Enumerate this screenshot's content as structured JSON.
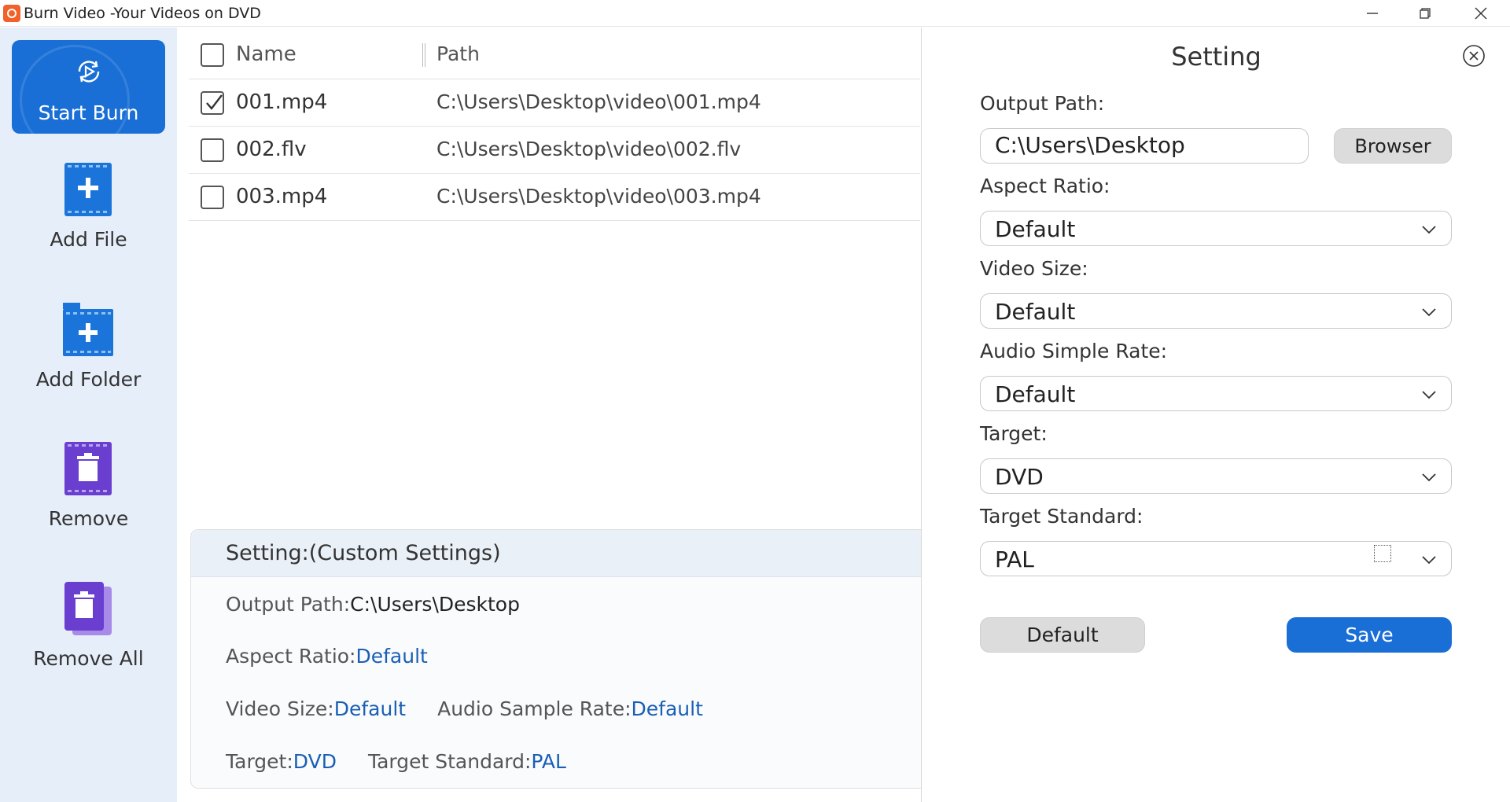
{
  "window": {
    "title": "Burn Video -Your Videos on DVD",
    "icon": "app-disc-icon"
  },
  "sidebar": {
    "start_burn": "Start Burn",
    "items": [
      {
        "label": "Add File",
        "icon": "add-file-icon"
      },
      {
        "label": "Add Folder",
        "icon": "add-folder-icon"
      },
      {
        "label": "Remove",
        "icon": "remove-icon"
      },
      {
        "label": "Remove All",
        "icon": "remove-all-icon"
      }
    ]
  },
  "filelist": {
    "columns": {
      "name": "Name",
      "path": "Path"
    },
    "rows": [
      {
        "name": "001.mp4",
        "path": "C:\\Users\\Desktop\\video\\001.mp4",
        "checked": true
      },
      {
        "name": "002.flv",
        "path": "C:\\Users\\Desktop\\video\\002.flv",
        "checked": false
      },
      {
        "name": "003.mp4",
        "path": "C:\\Users\\Desktop\\video\\003.mp4",
        "checked": false
      }
    ]
  },
  "summary": {
    "title": "Setting:(Custom Settings)",
    "output_path_label": "Output Path:",
    "output_path_value": "C:\\Users\\Desktop",
    "aspect_ratio_label": "Aspect Ratio:",
    "aspect_ratio_value": "Default",
    "video_size_label": "Video Size:",
    "video_size_value": "Default",
    "audio_rate_label": "Audio Sample Rate:",
    "audio_rate_value": "Default",
    "target_label": "Target:",
    "target_value": "DVD",
    "standard_label": "Target Standard:",
    "standard_value": "PAL"
  },
  "setting": {
    "title": "Setting",
    "output_path_label": "Output Path:",
    "output_path_value": "C:\\Users\\Desktop",
    "browser_button": "Browser",
    "aspect_ratio_label": "Aspect Ratio:",
    "aspect_ratio_value": "Default",
    "video_size_label": "Video Size:",
    "video_size_value": "Default",
    "audio_rate_label": "Audio Simple Rate:",
    "audio_rate_value": "Default",
    "target_label": "Target:",
    "target_value": "DVD",
    "standard_label": "Target Standard:",
    "standard_value": "PAL",
    "default_button": "Default",
    "save_button": "Save"
  },
  "colors": {
    "accent": "#1a6fd6",
    "sidebar_bg": "#e6eef9",
    "value_blue": "#1a5fb4",
    "remove_purple": "#6a3fd0"
  }
}
